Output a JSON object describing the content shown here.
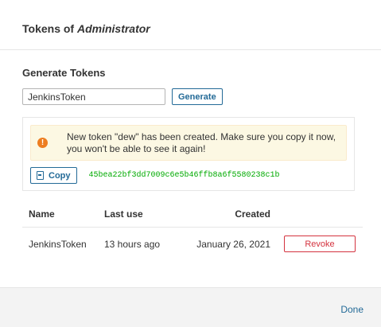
{
  "modal": {
    "title_prefix": "Tokens of",
    "title_name": "Administrator"
  },
  "generate": {
    "section_title": "Generate Tokens",
    "input_value": "JenkinsToken",
    "button_label": "Generate"
  },
  "alert": {
    "message": "New token \"dew\" has been created. Make sure you copy it now, you won't be able to see it again!",
    "icon": "exclamation-circle-icon",
    "color": "#ed7d20"
  },
  "new_token": {
    "copy_label": "Copy",
    "value": "45bea22bf3dd7009c6e5b46ffb8a6f5580238c1b",
    "value_color": "#00aa00"
  },
  "table": {
    "headers": [
      "Name",
      "Last use",
      "Created"
    ],
    "rows": [
      {
        "name": "JenkinsToken",
        "last_use": "13 hours ago",
        "created": "January 26, 2021",
        "action": "Revoke"
      }
    ]
  },
  "footer": {
    "done_label": "Done"
  },
  "colors": {
    "accent": "#236a97",
    "danger": "#d4333f",
    "alert_bg": "#fcf8e3",
    "footer_bg": "#f3f3f3"
  }
}
